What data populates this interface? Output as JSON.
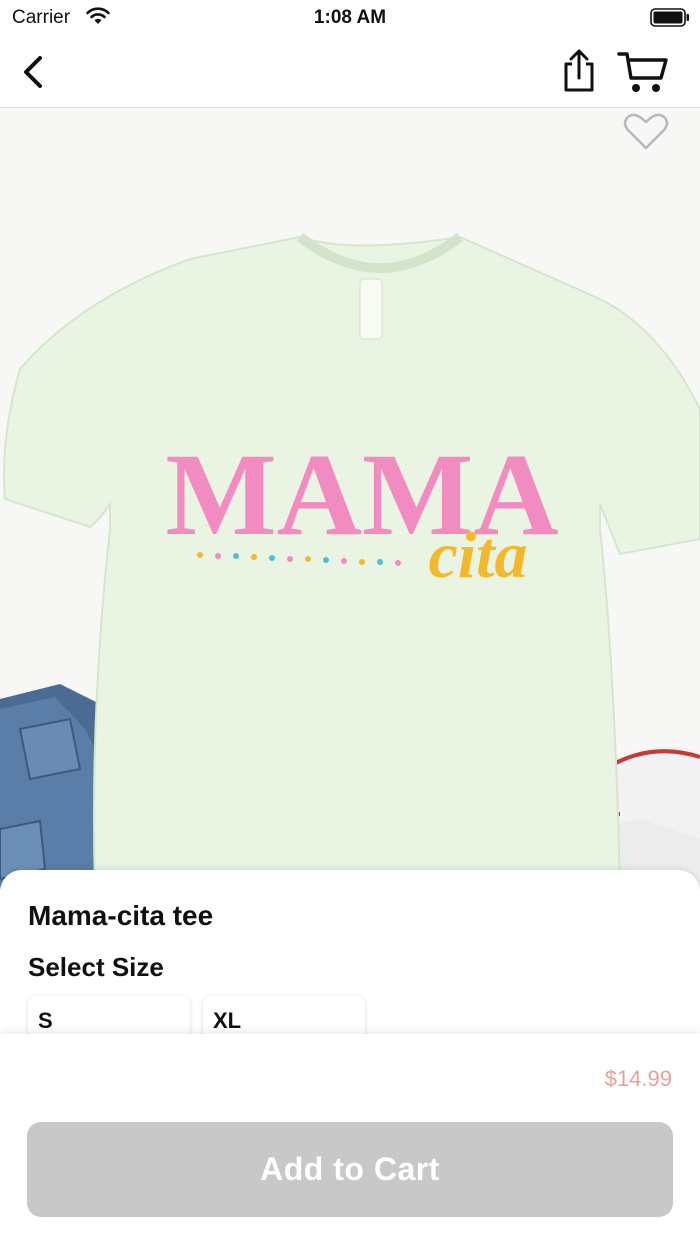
{
  "status_bar": {
    "carrier": "Carrier",
    "time": "1:08 AM"
  },
  "nav": {
    "back_icon": "chevron-left",
    "share_icon": "share",
    "cart_icon": "cart"
  },
  "product": {
    "name": "Mama-cita tee",
    "image_print_main": "MAMA",
    "image_print_script": "cita",
    "favorite_icon": "heart-outline",
    "size_heading": "Select Size",
    "sizes": [
      "S",
      "XL"
    ],
    "price": "$14.99"
  },
  "actions": {
    "add_to_cart_label": "Add to Cart"
  },
  "colors": {
    "price": "#e7a19a",
    "button_disabled": "#c8c8c8",
    "print_pink": "#f28cc0",
    "print_yellow": "#f3b92d",
    "shirt": "#e9f4e2"
  }
}
